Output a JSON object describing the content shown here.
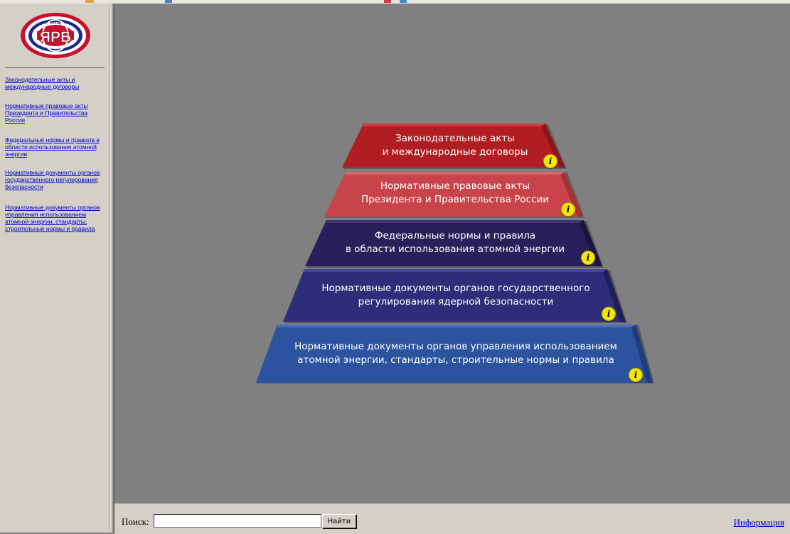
{
  "sidebar": {
    "logo": {
      "top_text": "НТЦ",
      "main_text": "ЯРБ",
      "colors": {
        "red": "#c8102e",
        "blue": "#1b2a86",
        "white": "#ffffff"
      }
    },
    "links": [
      {
        "label": "Законодательные акты и международные договоры"
      },
      {
        "label": "Нормативные правовые акты Президента и Правительства России"
      },
      {
        "label": "Федеральные нормы и правила в области использования атомной энергии"
      },
      {
        "label": "Нормативные документы органов государственного регулирования безопасности"
      },
      {
        "label": "Нормативные документы органов управления использованием атомной энергии, стандарты, строительные нормы и правила"
      }
    ]
  },
  "pyramid": {
    "info_icon": "info-icon",
    "info_glyph": "i",
    "tiers": [
      {
        "line1": "Законодательные акты",
        "line2": "и международные договоры",
        "color": "#b01e23"
      },
      {
        "line1": "Нормативные правовые акты",
        "line2": "Президента и Правительства России",
        "color": "#c8444a"
      },
      {
        "line1": "Федеральные нормы и правила",
        "line2": "в области использования атомной энергии",
        "color": "#28205a"
      },
      {
        "line1": "Нормативные документы органов государственного",
        "line2": "регулирования ядерной безопасности",
        "color": "#2e2d7a"
      },
      {
        "line1": "Нормативные документы органов управления использованием",
        "line2": "атомной энергии, стандарты, строительные нормы и правила",
        "color": "#2c539e"
      }
    ]
  },
  "search": {
    "label": "Поиск:",
    "value": "",
    "button_label": "Найти"
  },
  "footer": {
    "info_link": "Информация"
  }
}
